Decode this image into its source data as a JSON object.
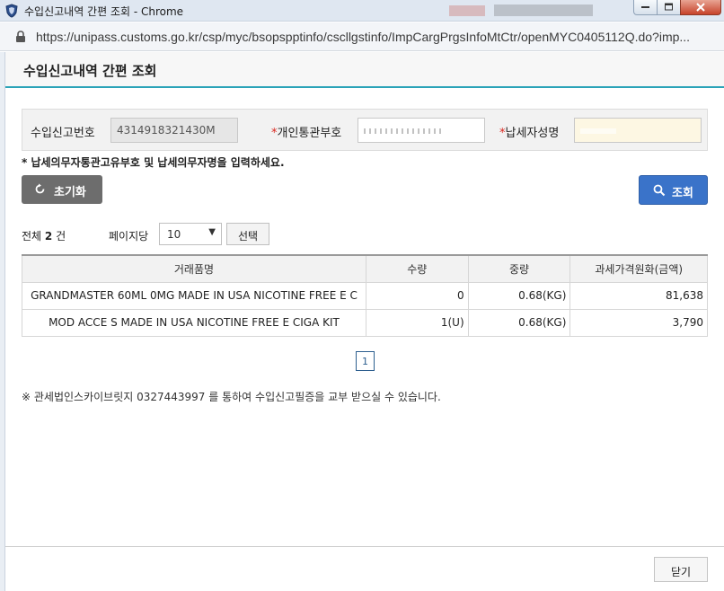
{
  "window": {
    "title": "수입신고내역 간편 조회 - Chrome",
    "url": "https://unipass.customs.go.kr/csp/myc/bsopspptinfo/cscllgstinfo/ImpCargPrgsInfoMtCtr/openMYC0405112Q.do?imp..."
  },
  "popup": {
    "heading": "수입신고내역 간편 조회"
  },
  "search": {
    "declaration_no_label": "수입신고번호",
    "declaration_no_value": "4314918321430M",
    "required_mark": "*",
    "customs_code_label": "개인통관부호",
    "taxpayer_name_label": "납세자성명",
    "notice": "* 납세의무자통관고유부호 및 납세의무자명을 입력하세요.",
    "reset_label": "초기화",
    "search_label": "조회"
  },
  "list": {
    "total_prefix": "전체",
    "total_count": "2",
    "total_suffix": "건",
    "per_page_label": "페이지당",
    "per_page_value": "10",
    "select_button": "선택",
    "columns": [
      "거래품명",
      "수량",
      "중량",
      "과세가격원화(금액)"
    ],
    "rows": [
      {
        "name": "GRANDMASTER 60ML 0MG MADE IN USA NICOTINE FREE E C",
        "qty": "0",
        "weight": "0.68(KG)",
        "price": "81,638"
      },
      {
        "name": "MOD ACCE S MADE IN USA NICOTINE FREE E CIGA KIT",
        "qty": "1(U)",
        "weight": "0.68(KG)",
        "price": "3,790"
      }
    ],
    "current_page": "1"
  },
  "footer": {
    "note": "※ 관세법인스카이브릿지 0327443997 를 통하여 수입신고필증을 교부 받으실 수 있습니다.",
    "close_label": "닫기"
  },
  "colors": {
    "accent": "#2aa3b8",
    "search_button": "#3a73c9",
    "reset_button": "#6d6d6d",
    "required": "#d9251d"
  }
}
